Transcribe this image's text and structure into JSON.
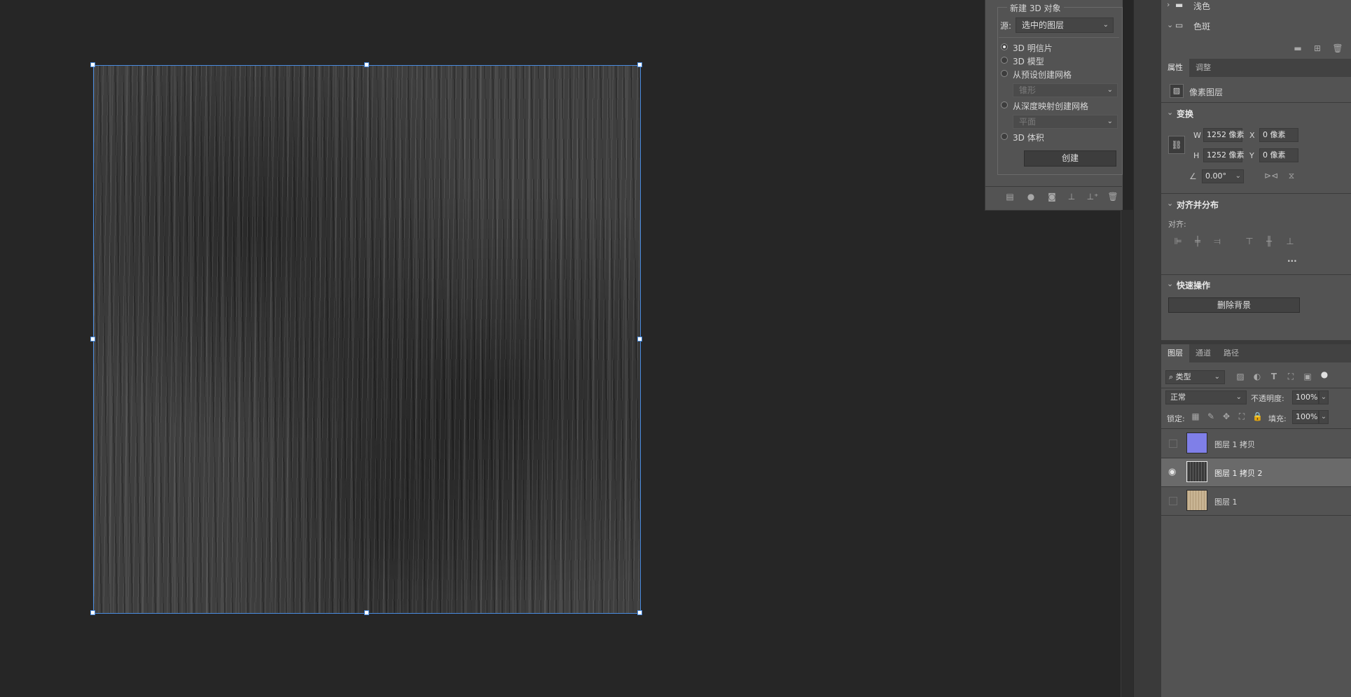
{
  "panel_3d": {
    "title": "新建 3D 对象",
    "source_label": "源:",
    "source_value": "选中的图层",
    "options": [
      {
        "label": "3D 明信片",
        "selected": true
      },
      {
        "label": "3D 模型",
        "selected": false
      },
      {
        "label": "从预设创建网格",
        "selected": false
      },
      {
        "label": "从深度映射创建网格",
        "selected": false
      },
      {
        "label": "3D 体积",
        "selected": false
      }
    ],
    "preset_value": "锥形",
    "depth_value": "平面",
    "create_button": "创建",
    "bottom_icons": [
      "scene-icon",
      "light-icon",
      "camera-icon",
      "ground-icon",
      "add-object-icon",
      "trash-icon"
    ]
  },
  "swatch_groups": [
    {
      "label": "浅色",
      "expanded": false
    },
    {
      "label": "色斑",
      "expanded": true
    }
  ],
  "properties": {
    "tabs": [
      "属性",
      "调整"
    ],
    "active_tab": "属性",
    "layer_type": "像素图层",
    "transform_title": "变换",
    "w_label": "W",
    "w_value": "1252 像素",
    "x_label": "X",
    "x_value": "0 像素",
    "h_label": "H",
    "h_value": "1252 像素",
    "y_label": "Y",
    "y_value": "0 像素",
    "angle_value": "0.00°",
    "align_title": "对齐并分布",
    "align_label": "对齐:",
    "more": "···",
    "quick_title": "快速操作",
    "remove_bg": "删除背景"
  },
  "layers_panel": {
    "tabs": [
      "图层",
      "通道",
      "路径"
    ],
    "active_tab": "图层",
    "filter_value": "类型",
    "blend_mode": "正常",
    "opacity_label": "不透明度:",
    "opacity_value": "100%",
    "lock_label": "锁定:",
    "fill_label": "填充:",
    "fill_value": "100%",
    "layers": [
      {
        "name": "图层 1 拷贝",
        "visible": false,
        "selected": false,
        "thumb_color": "#7f7fe8"
      },
      {
        "name": "图层 1 拷贝 2",
        "visible": true,
        "selected": true,
        "thumb_color": "#3a3a3a"
      },
      {
        "name": "图层 1",
        "visible": false,
        "selected": false,
        "thumb_color": "#c8b493"
      }
    ]
  }
}
